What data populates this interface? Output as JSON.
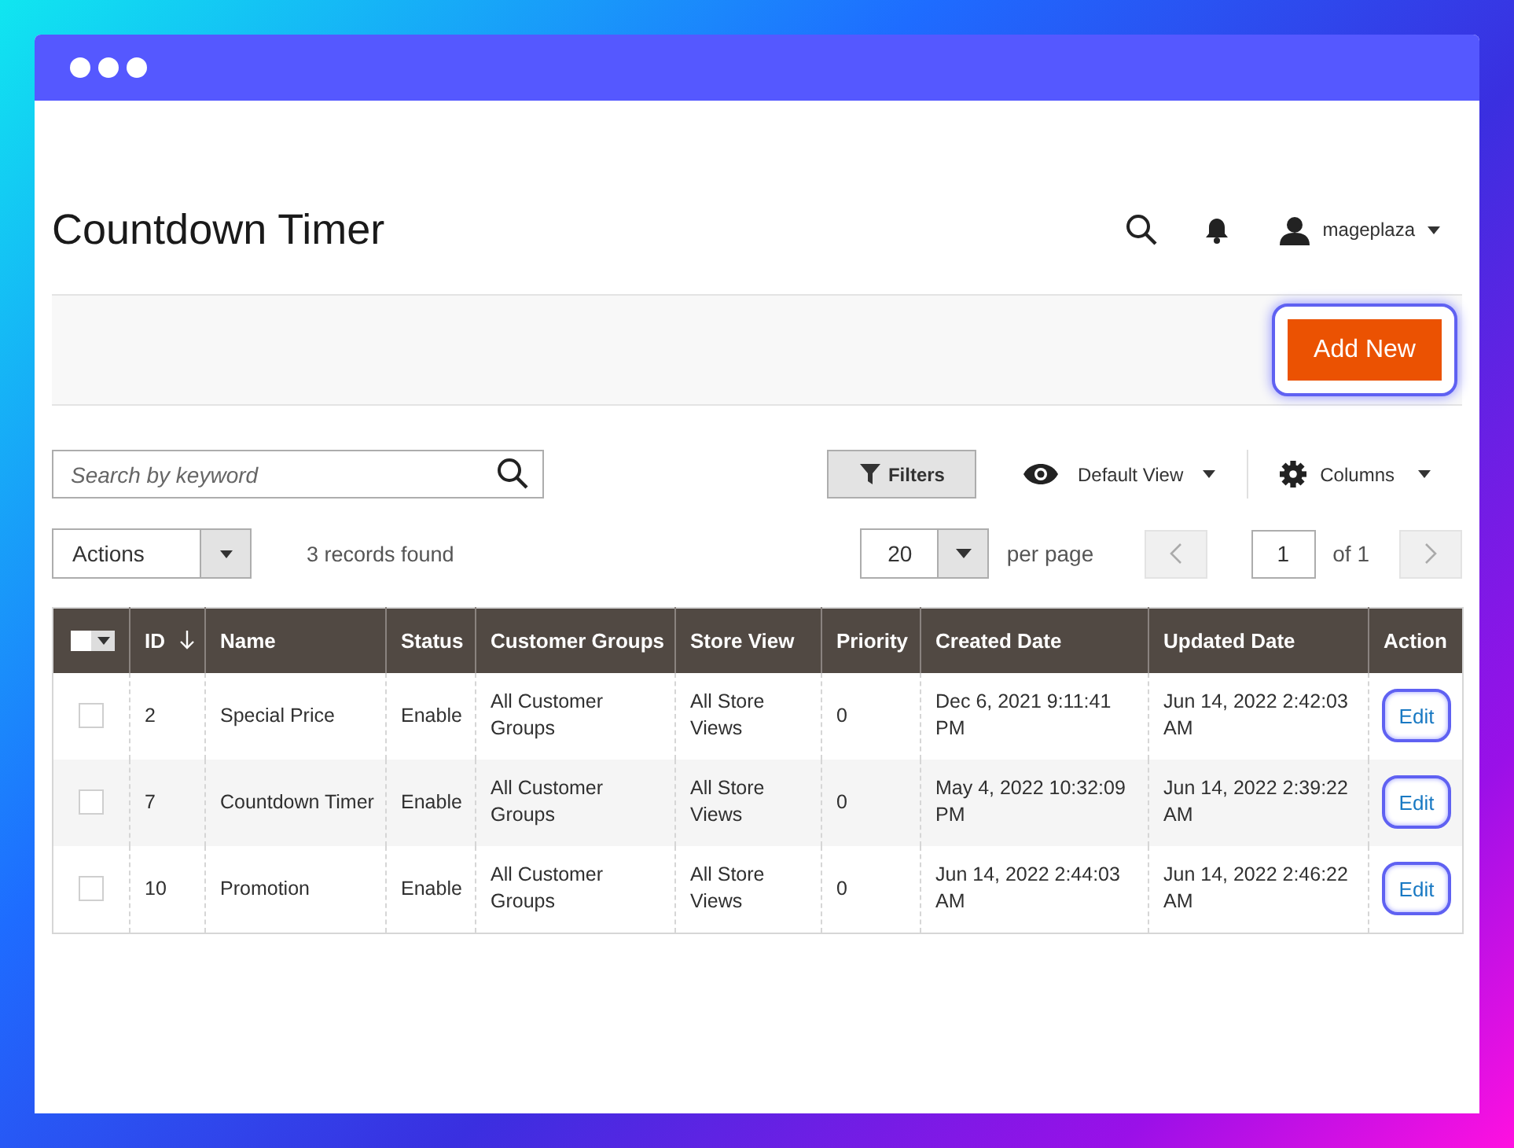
{
  "page": {
    "title": "Countdown Timer"
  },
  "header": {
    "user": "mageplaza"
  },
  "action_bar": {
    "add_button": {
      "label": "Add New",
      "highlighted": true
    }
  },
  "toolbar": {
    "search": {
      "placeholder": "Search by keyword"
    },
    "filters_button": "Filters",
    "view_switcher": "Default View",
    "columns_button": "Columns"
  },
  "pager_bar": {
    "actions": "Actions",
    "records_found": "3 records found",
    "page_size": "20",
    "per_page_label": "per page",
    "page_number": "1",
    "page_count": "of 1",
    "prev_disabled": true,
    "next_disabled": true
  },
  "table": {
    "select_all": {
      "checked": false
    },
    "columns": [
      {
        "label": "ID",
        "sorted": true
      },
      {
        "label": "Name",
        "sorted": false
      },
      {
        "label": "Status",
        "sorted": false
      },
      {
        "label": "Customer Groups",
        "sorted": false
      },
      {
        "label": "Store View",
        "sorted": false
      },
      {
        "label": "Priority",
        "sorted": false
      },
      {
        "label": "Created Date",
        "sorted": false
      },
      {
        "label": "Updated Date",
        "sorted": false
      },
      {
        "label": "Action",
        "sorted": false
      }
    ],
    "rows": [
      {
        "selected": false,
        "cells": [
          "2",
          "Special Price",
          "Enable",
          "All Customer Groups",
          "All Store Views",
          "0",
          "Dec 6, 2021 9:11:41 PM",
          "Jun 14, 2022 2:42:03 AM"
        ],
        "action": {
          "label": "Edit",
          "highlighted": true
        }
      },
      {
        "selected": false,
        "cells": [
          "7",
          "Countdown Timer",
          "Enable",
          "All Customer Groups",
          "All Store Views",
          "0",
          "May 4, 2022 10:32:09 PM",
          "Jun 14, 2022 2:39:22 AM"
        ],
        "action": {
          "label": "Edit",
          "highlighted": true
        }
      },
      {
        "selected": false,
        "cells": [
          "10",
          "Promotion",
          "Enable",
          "All Customer Groups",
          "All Store Views",
          "0",
          "Jun 14, 2022 2:44:03 AM",
          "Jun 14, 2022 2:46:22 AM"
        ],
        "action": {
          "label": "Edit",
          "highlighted": true
        }
      }
    ]
  }
}
